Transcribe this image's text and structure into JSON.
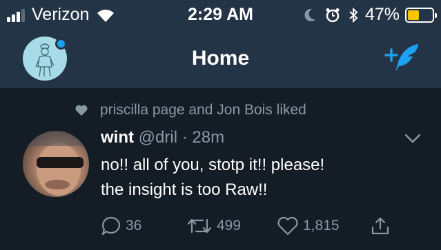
{
  "status_bar": {
    "carrier": "Verizon",
    "time": "2:29 AM",
    "battery_percent_label": "47%",
    "battery_level": 0.47,
    "signal_bars_active": 3,
    "signal_bars_total": 4,
    "icons": [
      "wifi-icon",
      "moon-icon",
      "alarm-icon",
      "bluetooth-icon",
      "battery-icon"
    ],
    "battery_color": "#f5c400"
  },
  "header": {
    "title": "Home",
    "profile_has_notification": true,
    "accent_color": "#1da1f2"
  },
  "tweet": {
    "social_context": "priscilla page and Jon Bois liked",
    "author_name": "wint",
    "author_handle": "@dril",
    "separator": "·",
    "timestamp": "28m",
    "text_line1": "no!!  all of you, stotp it!!  please!",
    "text_line2": "the insight is too Raw!!",
    "actions": {
      "replies": "36",
      "retweets": "499",
      "likes": "1,815"
    }
  },
  "theme": {
    "background": "#141d26",
    "header_background": "#243447",
    "secondary_text": "#8899a6"
  }
}
